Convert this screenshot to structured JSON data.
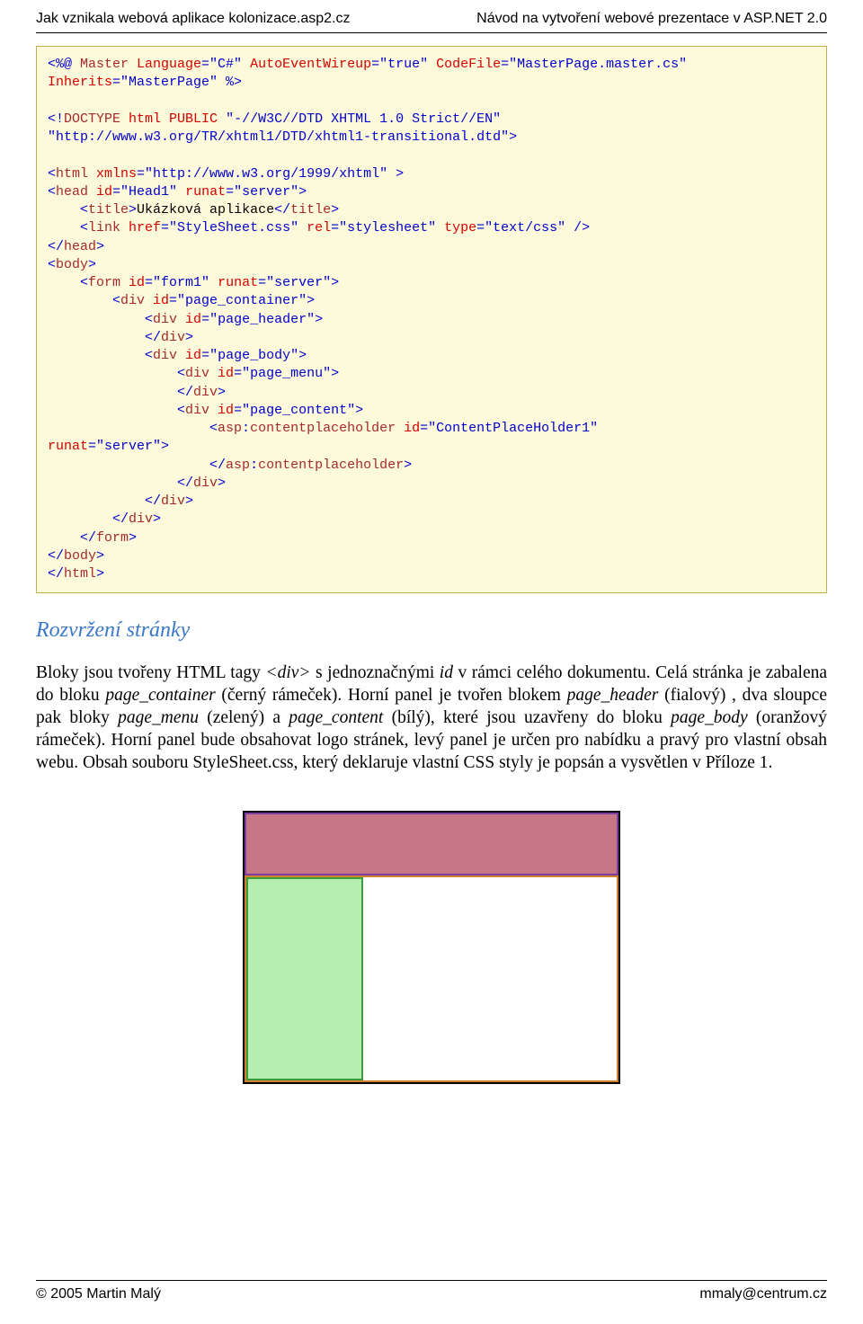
{
  "header": {
    "left": "Jak vznikala webová aplikace kolonizace.asp2.cz",
    "right": "Návod na vytvoření webové prezentace v ASP.NET 2.0"
  },
  "code": {
    "l1a": "<%@ ",
    "l1b": "Master",
    "l1c": " Language",
    "l1d": "=\"C#\"",
    "l1e": " AutoEventWireup",
    "l1f": "=\"true\"",
    "l1g": " CodeFile",
    "l1h": "=\"MasterPage.master.cs\"",
    "l2a": "Inherits",
    "l2b": "=\"MasterPage\"",
    "l2c": " %>",
    "l3": "",
    "l4a": "<!",
    "l4b": "DOCTYPE",
    "l4c": " html",
    "l4d": " PUBLIC",
    "l4e": " \"-//W3C//DTD XHTML 1.0 Strict//EN\"",
    "l5a": "\"http://www.w3.org/TR/xhtml1/DTD/xhtml1-transitional.dtd\">",
    "l6": "",
    "l7a": "<",
    "l7b": "html",
    "l7c": " xmlns",
    "l7d": "=\"http://www.w3.org/1999/xhtml\"",
    "l7e": " >",
    "l8a": "<",
    "l8b": "head",
    "l8c": " id",
    "l8d": "=\"Head1\"",
    "l8e": " runat",
    "l8f": "=\"server\">",
    "l9a": "    <",
    "l9b": "title",
    "l9c": ">",
    "l9d": "Ukázková aplikace",
    "l9e": "</",
    "l9f": "title",
    "l9g": ">",
    "l10a": "    <",
    "l10b": "link",
    "l10c": " href",
    "l10d": "=\"StyleSheet.css\"",
    "l10e": " rel",
    "l10f": "=\"stylesheet\"",
    "l10g": " type",
    "l10h": "=\"text/css\"",
    "l10i": " />",
    "l11a": "</",
    "l11b": "head",
    "l11c": ">",
    "l12a": "<",
    "l12b": "body",
    "l12c": ">",
    "l13a": "    <",
    "l13b": "form",
    "l13c": " id",
    "l13d": "=\"form1\"",
    "l13e": " runat",
    "l13f": "=\"server\">",
    "l14a": "        <",
    "l14b": "div",
    "l14c": " id",
    "l14d": "=\"page_container\">",
    "l15a": "            <",
    "l15b": "div",
    "l15c": " id",
    "l15d": "=\"page_header\">",
    "l16a": "            </",
    "l16b": "div",
    "l16c": ">",
    "l17a": "            <",
    "l17b": "div",
    "l17c": " id",
    "l17d": "=\"page_body\">",
    "l18a": "                <",
    "l18b": "div",
    "l18c": " id",
    "l18d": "=\"page_menu\">",
    "l19a": "                </",
    "l19b": "div",
    "l19c": ">",
    "l20a": "                <",
    "l20b": "div",
    "l20c": " id",
    "l20d": "=\"page_content\">",
    "l21a": "                    <",
    "l21b": "asp",
    "l21c": ":",
    "l21d": "contentplaceholder",
    "l21e": " id",
    "l21f": "=\"ContentPlaceHolder1\"",
    "l22a": "runat",
    "l22b": "=\"server\">",
    "l23a": "                    </",
    "l23b": "asp",
    "l23c": ":",
    "l23d": "contentplaceholder",
    "l23e": ">",
    "l24a": "                </",
    "l24b": "div",
    "l24c": ">",
    "l25a": "            </",
    "l25b": "div",
    "l25c": ">",
    "l26a": "        </",
    "l26b": "div",
    "l26c": ">",
    "l27a": "    </",
    "l27b": "form",
    "l27c": ">",
    "l28a": "</",
    "l28b": "body",
    "l28c": ">",
    "l29a": "</",
    "l29b": "html",
    "l29c": ">"
  },
  "section_title": "Rozvržení stránky",
  "body_text": {
    "p1a": "Bloky jsou tvořeny HTML tagy ",
    "p1b": "<div>",
    "p1c": " s jednoznačnými ",
    "p1d": "id",
    "p1e": " v rámci celého dokumentu. Celá stránka je zabalena do bloku ",
    "p1f": "page_container",
    "p1g": " (černý rámeček). Horní panel je tvořen blokem ",
    "p1h": "page_header",
    "p1i": " (fialový) , dva sloupce pak bloky ",
    "p1j": "page_menu",
    "p1k": " (zelený) a ",
    "p1l": "page_content",
    "p1m": " (bílý), které jsou uzavřeny do bloku ",
    "p1n": "page_body",
    "p1o": " (oranžový rámeček). Horní panel bude obsahovat logo stránek, levý panel je určen pro nabídku a pravý pro vlastní obsah webu. Obsah souboru StyleSheet.css, který deklaruje vlastní CSS styly je popsán a vysvětlen v Příloze 1."
  },
  "footer": {
    "left": "© 2005 Martin Malý",
    "right": "mmaly@centrum.cz"
  }
}
